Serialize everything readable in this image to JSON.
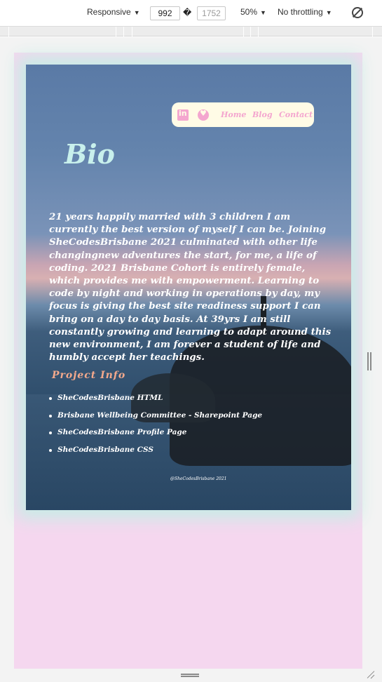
{
  "devtools": {
    "device": "Responsive",
    "width": "992",
    "height": "1752",
    "dim_separator": "�",
    "zoom": "50%",
    "throttling": "No throttling",
    "caret": "▼"
  },
  "site": {
    "nav": {
      "links": [
        "Home",
        "Blog",
        "Contact"
      ],
      "icons": [
        "linkedin-icon",
        "heart-icon"
      ]
    },
    "bio_title": "Bio",
    "bio_text": "21 years happily married with 3 children I am currently the best version of myself I can be. Joining SheCodesBrisbane 2021 culminated with other life changingnew adventures the start, for me, a life of coding. 2021 Brisbane Cohort is entirely female, which provides me with empowerment. Learning to code by night and working in operations by day, my focus is giving the best site readiness support I can bring on a day to day basis. At 39yrs I am still constantly growing and learning to adapt around this new environment, I am forever a student of life and humbly accept her teachings.",
    "project_title": "Project Info",
    "projects": [
      "SheCodesBrisbane HTML",
      "Brisbane Wellbeing Committee - Sharepoint Page",
      "SheCodesBrisbane Profile Page",
      "SheCodesBrisbane CSS"
    ],
    "footer": "@SheCodesBrisbane 2021"
  },
  "colors": {
    "page_bg": "#f5d7ef",
    "glow": "#c8ece6",
    "nav_bg": "#fffbe6",
    "accent_pink": "#f4a6cf",
    "title_mint": "#c8f0ec",
    "project_orange": "#f4a98c"
  }
}
